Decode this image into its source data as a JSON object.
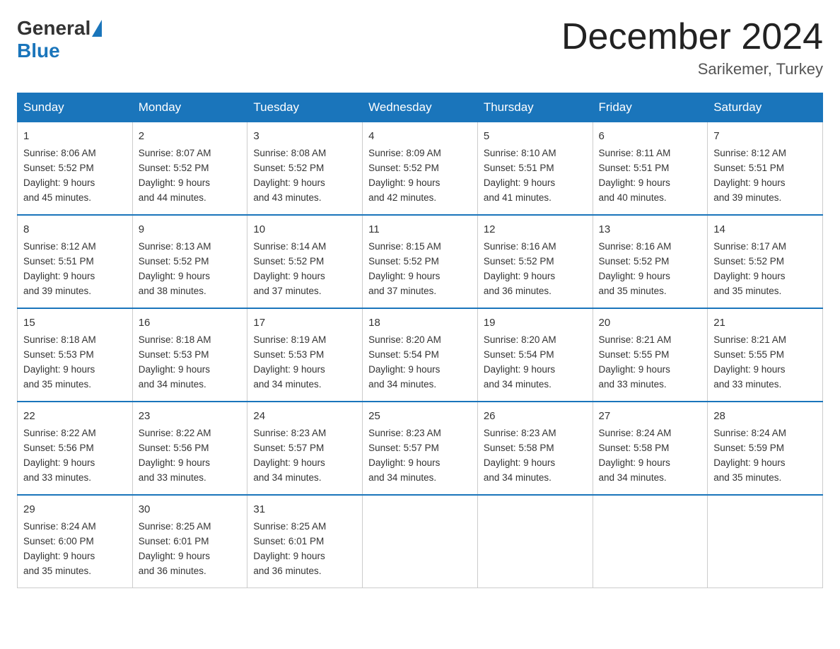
{
  "logo": {
    "general": "General",
    "blue": "Blue"
  },
  "title": "December 2024",
  "location": "Sarikemer, Turkey",
  "days_of_week": [
    "Sunday",
    "Monday",
    "Tuesday",
    "Wednesday",
    "Thursday",
    "Friday",
    "Saturday"
  ],
  "weeks": [
    [
      {
        "day": "1",
        "sunrise": "8:06 AM",
        "sunset": "5:52 PM",
        "daylight": "9 hours and 45 minutes."
      },
      {
        "day": "2",
        "sunrise": "8:07 AM",
        "sunset": "5:52 PM",
        "daylight": "9 hours and 44 minutes."
      },
      {
        "day": "3",
        "sunrise": "8:08 AM",
        "sunset": "5:52 PM",
        "daylight": "9 hours and 43 minutes."
      },
      {
        "day": "4",
        "sunrise": "8:09 AM",
        "sunset": "5:52 PM",
        "daylight": "9 hours and 42 minutes."
      },
      {
        "day": "5",
        "sunrise": "8:10 AM",
        "sunset": "5:51 PM",
        "daylight": "9 hours and 41 minutes."
      },
      {
        "day": "6",
        "sunrise": "8:11 AM",
        "sunset": "5:51 PM",
        "daylight": "9 hours and 40 minutes."
      },
      {
        "day": "7",
        "sunrise": "8:12 AM",
        "sunset": "5:51 PM",
        "daylight": "9 hours and 39 minutes."
      }
    ],
    [
      {
        "day": "8",
        "sunrise": "8:12 AM",
        "sunset": "5:51 PM",
        "daylight": "9 hours and 39 minutes."
      },
      {
        "day": "9",
        "sunrise": "8:13 AM",
        "sunset": "5:52 PM",
        "daylight": "9 hours and 38 minutes."
      },
      {
        "day": "10",
        "sunrise": "8:14 AM",
        "sunset": "5:52 PM",
        "daylight": "9 hours and 37 minutes."
      },
      {
        "day": "11",
        "sunrise": "8:15 AM",
        "sunset": "5:52 PM",
        "daylight": "9 hours and 37 minutes."
      },
      {
        "day": "12",
        "sunrise": "8:16 AM",
        "sunset": "5:52 PM",
        "daylight": "9 hours and 36 minutes."
      },
      {
        "day": "13",
        "sunrise": "8:16 AM",
        "sunset": "5:52 PM",
        "daylight": "9 hours and 35 minutes."
      },
      {
        "day": "14",
        "sunrise": "8:17 AM",
        "sunset": "5:52 PM",
        "daylight": "9 hours and 35 minutes."
      }
    ],
    [
      {
        "day": "15",
        "sunrise": "8:18 AM",
        "sunset": "5:53 PM",
        "daylight": "9 hours and 35 minutes."
      },
      {
        "day": "16",
        "sunrise": "8:18 AM",
        "sunset": "5:53 PM",
        "daylight": "9 hours and 34 minutes."
      },
      {
        "day": "17",
        "sunrise": "8:19 AM",
        "sunset": "5:53 PM",
        "daylight": "9 hours and 34 minutes."
      },
      {
        "day": "18",
        "sunrise": "8:20 AM",
        "sunset": "5:54 PM",
        "daylight": "9 hours and 34 minutes."
      },
      {
        "day": "19",
        "sunrise": "8:20 AM",
        "sunset": "5:54 PM",
        "daylight": "9 hours and 34 minutes."
      },
      {
        "day": "20",
        "sunrise": "8:21 AM",
        "sunset": "5:55 PM",
        "daylight": "9 hours and 33 minutes."
      },
      {
        "day": "21",
        "sunrise": "8:21 AM",
        "sunset": "5:55 PM",
        "daylight": "9 hours and 33 minutes."
      }
    ],
    [
      {
        "day": "22",
        "sunrise": "8:22 AM",
        "sunset": "5:56 PM",
        "daylight": "9 hours and 33 minutes."
      },
      {
        "day": "23",
        "sunrise": "8:22 AM",
        "sunset": "5:56 PM",
        "daylight": "9 hours and 33 minutes."
      },
      {
        "day": "24",
        "sunrise": "8:23 AM",
        "sunset": "5:57 PM",
        "daylight": "9 hours and 34 minutes."
      },
      {
        "day": "25",
        "sunrise": "8:23 AM",
        "sunset": "5:57 PM",
        "daylight": "9 hours and 34 minutes."
      },
      {
        "day": "26",
        "sunrise": "8:23 AM",
        "sunset": "5:58 PM",
        "daylight": "9 hours and 34 minutes."
      },
      {
        "day": "27",
        "sunrise": "8:24 AM",
        "sunset": "5:58 PM",
        "daylight": "9 hours and 34 minutes."
      },
      {
        "day": "28",
        "sunrise": "8:24 AM",
        "sunset": "5:59 PM",
        "daylight": "9 hours and 35 minutes."
      }
    ],
    [
      {
        "day": "29",
        "sunrise": "8:24 AM",
        "sunset": "6:00 PM",
        "daylight": "9 hours and 35 minutes."
      },
      {
        "day": "30",
        "sunrise": "8:25 AM",
        "sunset": "6:01 PM",
        "daylight": "9 hours and 36 minutes."
      },
      {
        "day": "31",
        "sunrise": "8:25 AM",
        "sunset": "6:01 PM",
        "daylight": "9 hours and 36 minutes."
      },
      null,
      null,
      null,
      null
    ]
  ],
  "labels": {
    "sunrise": "Sunrise:",
    "sunset": "Sunset:",
    "daylight": "Daylight:"
  }
}
